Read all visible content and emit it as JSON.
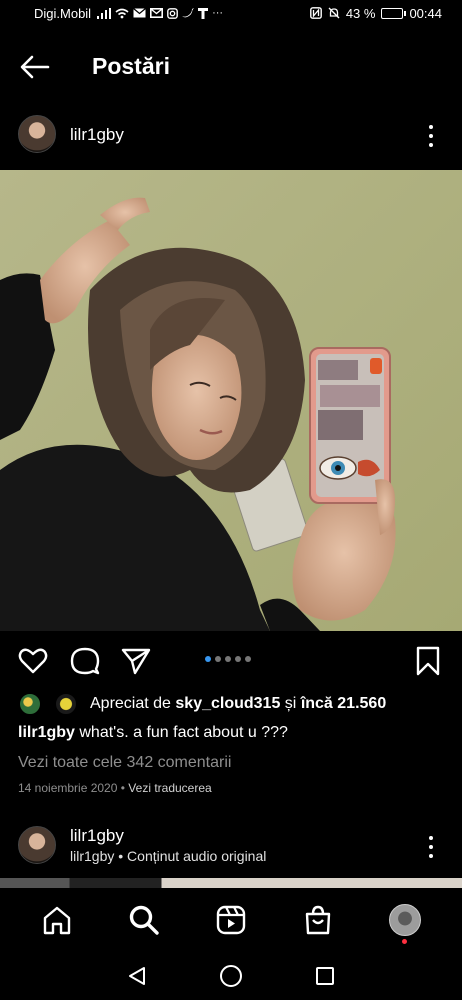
{
  "status_bar": {
    "carrier": "Digi.Mobil",
    "battery": "43 %",
    "battery_level": 0.43,
    "time": "00:44"
  },
  "header": {
    "title": "Postări"
  },
  "post": {
    "username": "lilr1gby",
    "liked_by_prefix": "Apreciat de",
    "liked_by_user": "sky_cloud315",
    "liked_by_and": "și",
    "liked_by_rest": "încă 21.560",
    "caption_user": "lilr1gby",
    "caption_text": "what's. a fun fact about u ???",
    "view_comments": "Vezi toate cele 342 comentarii",
    "date": "14 noiembrie 2020",
    "separator": "•",
    "translate": "Vezi traducerea",
    "carousel_count": 5,
    "carousel_active": 1
  },
  "next_post": {
    "username": "lilr1gby",
    "audio_user": "lilr1gby",
    "audio_separator": "•",
    "audio_label": "Conținut audio original"
  },
  "icons": {
    "back": "arrow-left-icon",
    "more": "more-vertical-icon",
    "like": "heart-icon",
    "comment": "comment-icon",
    "share": "send-icon",
    "save": "bookmark-icon",
    "home": "home-icon",
    "search": "search-icon",
    "reels": "reels-icon",
    "shop": "shop-icon"
  },
  "colors": {
    "background": "#000000",
    "active_dot": "#3897f0",
    "secondary_text": "#8e8e8e",
    "notification": "#ff3040"
  }
}
